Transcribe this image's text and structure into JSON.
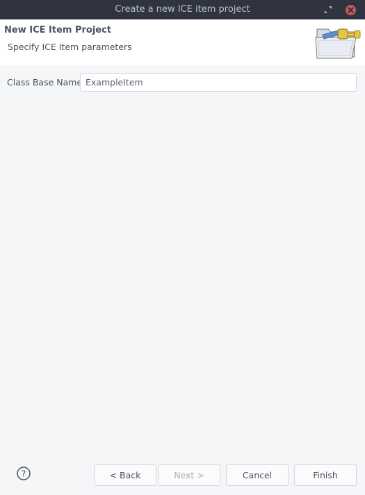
{
  "window": {
    "title": "Create a new ICE item project"
  },
  "header": {
    "title": "New ICE Item Project",
    "subtitle": "Specify ICE Item parameters",
    "icon": "folder-plug-icon"
  },
  "form": {
    "class_base_name": {
      "label": "Class Base Name",
      "value": "ExampleItem"
    }
  },
  "footer": {
    "help_icon": "help-icon",
    "back_label": "< Back",
    "next_label": "Next >",
    "cancel_label": "Cancel",
    "finish_label": "Finish"
  },
  "colors": {
    "titlebar": "#2f343f",
    "close": "#cc575d",
    "body": "#f5f6f7",
    "text": "#4b5162"
  }
}
